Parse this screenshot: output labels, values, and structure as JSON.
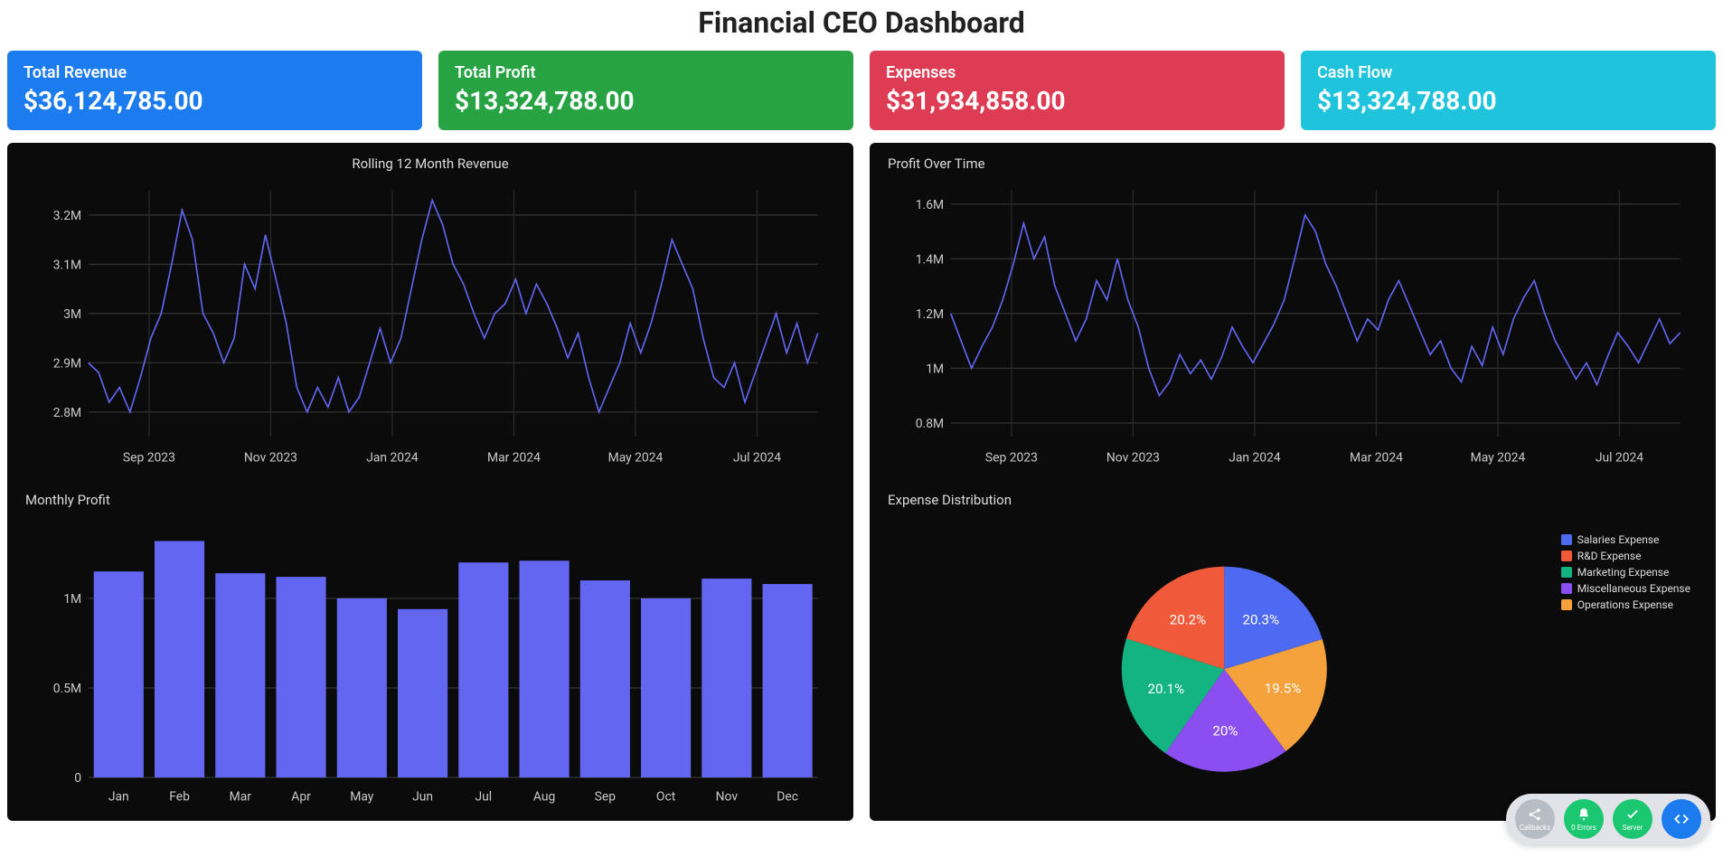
{
  "title": "Financial CEO Dashboard",
  "kpi": [
    {
      "label": "Total Revenue",
      "value": "$36,124,785.00",
      "class": "blue"
    },
    {
      "label": "Total Profit",
      "value": "$13,324,788.00",
      "class": "green"
    },
    {
      "label": "Expenses",
      "value": "$31,934,858.00",
      "class": "red"
    },
    {
      "label": "Cash Flow",
      "value": "$13,324,788.00",
      "class": "cyan"
    }
  ],
  "toolbar": {
    "callbacks": "Callbacks",
    "errors": "0 Errors",
    "server": "Server"
  },
  "chart_data": [
    {
      "id": "revenue",
      "type": "line",
      "title": "Rolling 12 Month Revenue",
      "ylim": [
        2750000,
        3250000
      ],
      "yticks": [
        2800000,
        2900000,
        3000000,
        3100000,
        3200000
      ],
      "ytick_labels": [
        "2.8M",
        "2.9M",
        "3M",
        "3.1M",
        "3.2M"
      ],
      "x_tick_labels": [
        "Sep 2023",
        "Nov 2023",
        "Jan 2024",
        "Mar 2024",
        "May 2024",
        "Jul 2024"
      ],
      "values": [
        2900000,
        2880000,
        2820000,
        2850000,
        2800000,
        2870000,
        2950000,
        3000000,
        3100000,
        3210000,
        3150000,
        3000000,
        2960000,
        2900000,
        2950000,
        3100000,
        3050000,
        3160000,
        3070000,
        2980000,
        2850000,
        2800000,
        2850000,
        2810000,
        2870000,
        2800000,
        2830000,
        2900000,
        2970000,
        2900000,
        2950000,
        3050000,
        3150000,
        3230000,
        3180000,
        3100000,
        3060000,
        3000000,
        2950000,
        3000000,
        3020000,
        3070000,
        3000000,
        3060000,
        3020000,
        2970000,
        2910000,
        2960000,
        2870000,
        2800000,
        2850000,
        2900000,
        2980000,
        2920000,
        2980000,
        3060000,
        3150000,
        3100000,
        3050000,
        2950000,
        2870000,
        2850000,
        2900000,
        2820000,
        2880000,
        2940000,
        3000000,
        2920000,
        2980000,
        2900000,
        2960000
      ]
    },
    {
      "id": "profit_time",
      "type": "line",
      "title": "Profit Over Time",
      "ylim": [
        750000,
        1650000
      ],
      "yticks": [
        800000,
        1000000,
        1200000,
        1400000,
        1600000
      ],
      "ytick_labels": [
        "0.8M",
        "1M",
        "1.2M",
        "1.4M",
        "1.6M"
      ],
      "x_tick_labels": [
        "Sep 2023",
        "Nov 2023",
        "Jan 2024",
        "Mar 2024",
        "May 2024",
        "Jul 2024"
      ],
      "values": [
        1200000,
        1100000,
        1000000,
        1080000,
        1150000,
        1250000,
        1380000,
        1530000,
        1400000,
        1480000,
        1300000,
        1200000,
        1100000,
        1180000,
        1320000,
        1250000,
        1400000,
        1250000,
        1150000,
        1000000,
        900000,
        950000,
        1050000,
        980000,
        1030000,
        960000,
        1040000,
        1150000,
        1080000,
        1020000,
        1090000,
        1160000,
        1250000,
        1400000,
        1560000,
        1500000,
        1380000,
        1300000,
        1200000,
        1100000,
        1180000,
        1140000,
        1250000,
        1320000,
        1230000,
        1140000,
        1050000,
        1100000,
        1000000,
        950000,
        1080000,
        1010000,
        1150000,
        1050000,
        1180000,
        1260000,
        1320000,
        1200000,
        1100000,
        1030000,
        960000,
        1020000,
        940000,
        1040000,
        1130000,
        1080000,
        1020000,
        1100000,
        1180000,
        1090000,
        1130000
      ]
    },
    {
      "id": "monthly_profit",
      "type": "bar",
      "title": "Monthly Profit",
      "ylim": [
        0,
        1400000
      ],
      "yticks": [
        0,
        500000,
        1000000
      ],
      "ytick_labels": [
        "0",
        "0.5M",
        "1M"
      ],
      "categories": [
        "Jan",
        "Feb",
        "Mar",
        "Apr",
        "May",
        "Jun",
        "Jul",
        "Aug",
        "Sep",
        "Oct",
        "Nov",
        "Dec"
      ],
      "values": [
        1150000,
        1320000,
        1140000,
        1120000,
        1000000,
        940000,
        1200000,
        1210000,
        1100000,
        1000000,
        1110000,
        1080000
      ]
    },
    {
      "id": "expense_dist",
      "type": "pie",
      "title": "Expense Distribution",
      "series": [
        {
          "name": "Salaries Expense",
          "value": 20.3,
          "color": "#4f6af2"
        },
        {
          "name": "R&D Expense",
          "value": 20.2,
          "color": "#f05a3b"
        },
        {
          "name": "Marketing Expense",
          "value": 20.1,
          "color": "#14b482"
        },
        {
          "name": "Miscellaneous Expense",
          "value": 20.0,
          "color": "#8b4ef0"
        },
        {
          "name": "Operations Expense",
          "value": 19.5,
          "color": "#f5a13c"
        }
      ]
    }
  ]
}
